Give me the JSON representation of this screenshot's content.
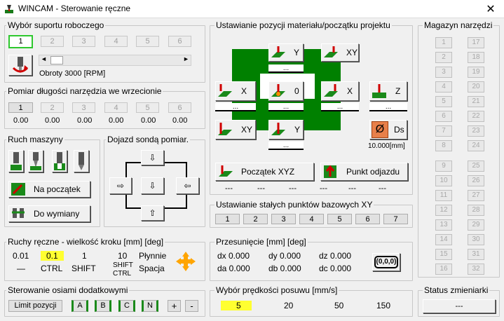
{
  "window": {
    "title": "WINCAM - Sterowanie ręczne",
    "close": "✕"
  },
  "support": {
    "title": "Wybór suportu roboczego",
    "buttons": [
      "1",
      "2",
      "3",
      "4",
      "5",
      "6"
    ],
    "speed": "Obroty 3000 [RPM]",
    "scroll_left": "◄",
    "scroll_right": "►"
  },
  "measure": {
    "title": "Pomiar długości narzędzia we wrzecionie",
    "buttons": [
      "1",
      "2",
      "3",
      "4",
      "5",
      "6"
    ],
    "values": [
      "0.00",
      "0.00",
      "0.00",
      "0.00",
      "0.00",
      "0.00"
    ]
  },
  "machine": {
    "title": "Ruch maszyny",
    "start_label": "Na początek",
    "change_label": "Do wymiany"
  },
  "probe": {
    "title": "Dojazd sondą pomiar."
  },
  "position": {
    "title": "Ustawianie pozycji materiału/początku projektu",
    "y_label": "Y",
    "xy_label": "XY",
    "x_label": "X",
    "zero_label": "0",
    "z_label": "Z",
    "ds_label": "Ds",
    "ds_value": "10.000[mm]",
    "start_xyz_label": "Początek XYZ",
    "approach_label": "Punkt odjazdu",
    "dots": "...",
    "dashes": "---"
  },
  "base_points": {
    "title": "Ustawianie stałych punktów  bazowych XY",
    "buttons": [
      "1",
      "2",
      "3",
      "4",
      "5",
      "6",
      "7"
    ]
  },
  "jog": {
    "title": "Ruchy ręczne - wielkość kroku [mm] [deg]",
    "steps": [
      "0.01",
      "0.1",
      "1",
      "10",
      "Płynnie"
    ],
    "keys": [
      "—",
      "CTRL",
      "SHIFT",
      "SHIFT",
      "CTRL",
      "Spacja"
    ]
  },
  "offset": {
    "title": "Przesunięcie [mm] [deg]",
    "dx": "dx 0.000",
    "dy": "dy 0.000",
    "dz": "dz 0.000",
    "da": "da 0.000",
    "db": "db 0.000",
    "dc": "dc 0.000",
    "reset_label": "(0,0,0)"
  },
  "aux": {
    "title": "Sterowanie osiami dodatkowymi",
    "limit_label": "Limit pozycji",
    "axes": [
      "A",
      "B",
      "C",
      "N"
    ],
    "plus": "+",
    "minus": "-"
  },
  "feed": {
    "title": "Wybór prędkości posuwu [mm/s]",
    "speeds": [
      "5",
      "20",
      "50",
      "150"
    ]
  },
  "magazine": {
    "title": "Magazyn narzędzi",
    "left": [
      "1",
      "2",
      "3",
      "4",
      "5",
      "6",
      "7",
      "8",
      "9",
      "10",
      "11",
      "12",
      "13",
      "14",
      "15",
      "16"
    ],
    "right": [
      "17",
      "18",
      "19",
      "20",
      "21",
      "22",
      "23",
      "24",
      "25",
      "26",
      "27",
      "28",
      "29",
      "30",
      "31",
      "32"
    ]
  },
  "changer": {
    "title": "Status zmieniarki",
    "status": "---"
  },
  "colors": {
    "green": "#008000",
    "highlight": "#ffff30",
    "accent_red": "#d00000",
    "active_border": "#2ec82e"
  }
}
